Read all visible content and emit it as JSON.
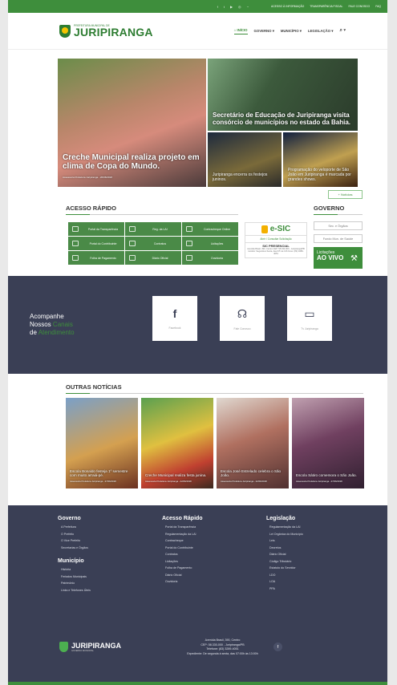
{
  "topbar": {
    "icons": [
      "facebook-icon",
      "twitter-icon",
      "youtube-icon",
      "instagram-icon",
      "rss-icon"
    ],
    "links": [
      "ACESSO À INFORMAÇÃO",
      "TRANSPARÊNCIA FISCAL",
      "FALE CONOSCO",
      "FAQ"
    ]
  },
  "header": {
    "logo_small": "PREFEITURA MUNICIPAL DE",
    "logo_big": "JURIPIRANGA",
    "nav": [
      "INÍCIO",
      "GOVERNO",
      "MUNICÍPIO",
      "LEGISLAÇÃO"
    ]
  },
  "news": {
    "main": {
      "title": "Creche Municipal realiza projeto em clima de Copa do Mundo.",
      "source": "Assessoria Prefeitura Juripiranga - 26/06/2018"
    },
    "second": {
      "title": "Secretário de Educação de Juripiranga visita consórcio de municípios no estado da Bahia."
    },
    "small1": {
      "title": "Juripiranga encerra os festejos juninos."
    },
    "small2": {
      "title": "Programação do veloporte de São João em Juripiranga é marcada por grandes shows."
    },
    "more_button": "+ Notícias"
  },
  "quick": {
    "title": "ACESSO RÁPIDO",
    "items": [
      "Portal da Transparência",
      "Reg. da LAI",
      "Contracheque Online",
      "Portal do Contribuinte",
      "Contratos",
      "Licitações",
      "Folha de Pagamento",
      "Diário Oficial",
      "Ouvidoria"
    ],
    "esic_logo": "e-SIC",
    "esic_link": "Abrir / Consultar Solicitação",
    "sic_title": "SIC PRESENCIAL",
    "sic_text": "Avenida Brasil, 390, Centro CEP: 58.330-000 - Juripiranga/PB Horário: Segunda à Sexta, das 07h às 13h Fone: (83) 3289-4051"
  },
  "gov": {
    "title": "GOVERNO",
    "inputs": [
      "Sec. e Órgãos",
      "Fundo Mun. de Saúde"
    ],
    "live_line1": "Licitações",
    "live_line2": "AO VIVO"
  },
  "channels": {
    "line1": "Acompanhe",
    "line2a": "Nossos",
    "line2b": "Canais",
    "line3a": "de",
    "line3b": "Atendimento",
    "boxes": [
      {
        "label": "Facebook",
        "icon": "facebook-icon"
      },
      {
        "label": "Fale Conosco",
        "icon": "headset-icon"
      },
      {
        "label": "Tv Juripiranga",
        "icon": "monitor-icon"
      }
    ]
  },
  "others": {
    "title": "OUTRAS NOTÍCIAS",
    "items": [
      {
        "title": "Escola Bonaldo festeja 1º semestre com muito arraiá-pé.",
        "source": "Assessoria Prefeitura Juripiranga - 27/06/2018"
      },
      {
        "title": "Creche Municipal realiza festa junina.",
        "source": "Assessoria Prefeitura Juripiranga - 22/06/2018"
      },
      {
        "title": "Escola José Estrelado celebra o São João.",
        "source": "Assessoria Prefeitura Juripiranga - 22/06/2018"
      },
      {
        "title": "Escola Sátiro comemora o São João.",
        "source": "Assessoria Prefeitura Juripiranga - 27/06/2018"
      }
    ]
  },
  "footer": {
    "governo": {
      "title": "Governo",
      "items": [
        "A Prefeitura",
        "O Prefeito",
        "O Vice Prefeito",
        "Secretarias e Órgãos"
      ]
    },
    "municipio": {
      "title": "Município",
      "items": [
        "História",
        "Feriados Municipais",
        "Patrimônio",
        "Links e Telefones Úteis"
      ]
    },
    "acesso": {
      "title": "Acesso Rápido",
      "items": [
        "Portal da Transparência",
        "Regulamentação da LAI",
        "Contracheque",
        "Portal do Contribuinte",
        "Contratos",
        "Licitações",
        "Folha de Pagamento",
        "Diário Oficial",
        "Ouvidoria"
      ]
    },
    "legislacao": {
      "title": "Legislação",
      "items": [
        "Regulamentação da LAI",
        "Lei Orgânica do Município",
        "Leis",
        "Decretos",
        "Diário Oficial",
        "Código Tributário",
        "Estatuto do Servidor",
        "LDO",
        "LOA",
        "PPA"
      ]
    },
    "logo_big": "JURIPIRANGA",
    "logo_small": "GOVERNO MUNICIPAL",
    "address": [
      "Avenida Brasil, 390, Centro",
      "CEP: 58.330-000 - Juripiranga/PB",
      "Telefone: (83) 3289-4051",
      "Expediente: De segunda à sexta, das 07:00h às 13:00h"
    ]
  },
  "colors": {
    "green": "#3e8e3c",
    "dark": "#3a3f55"
  }
}
